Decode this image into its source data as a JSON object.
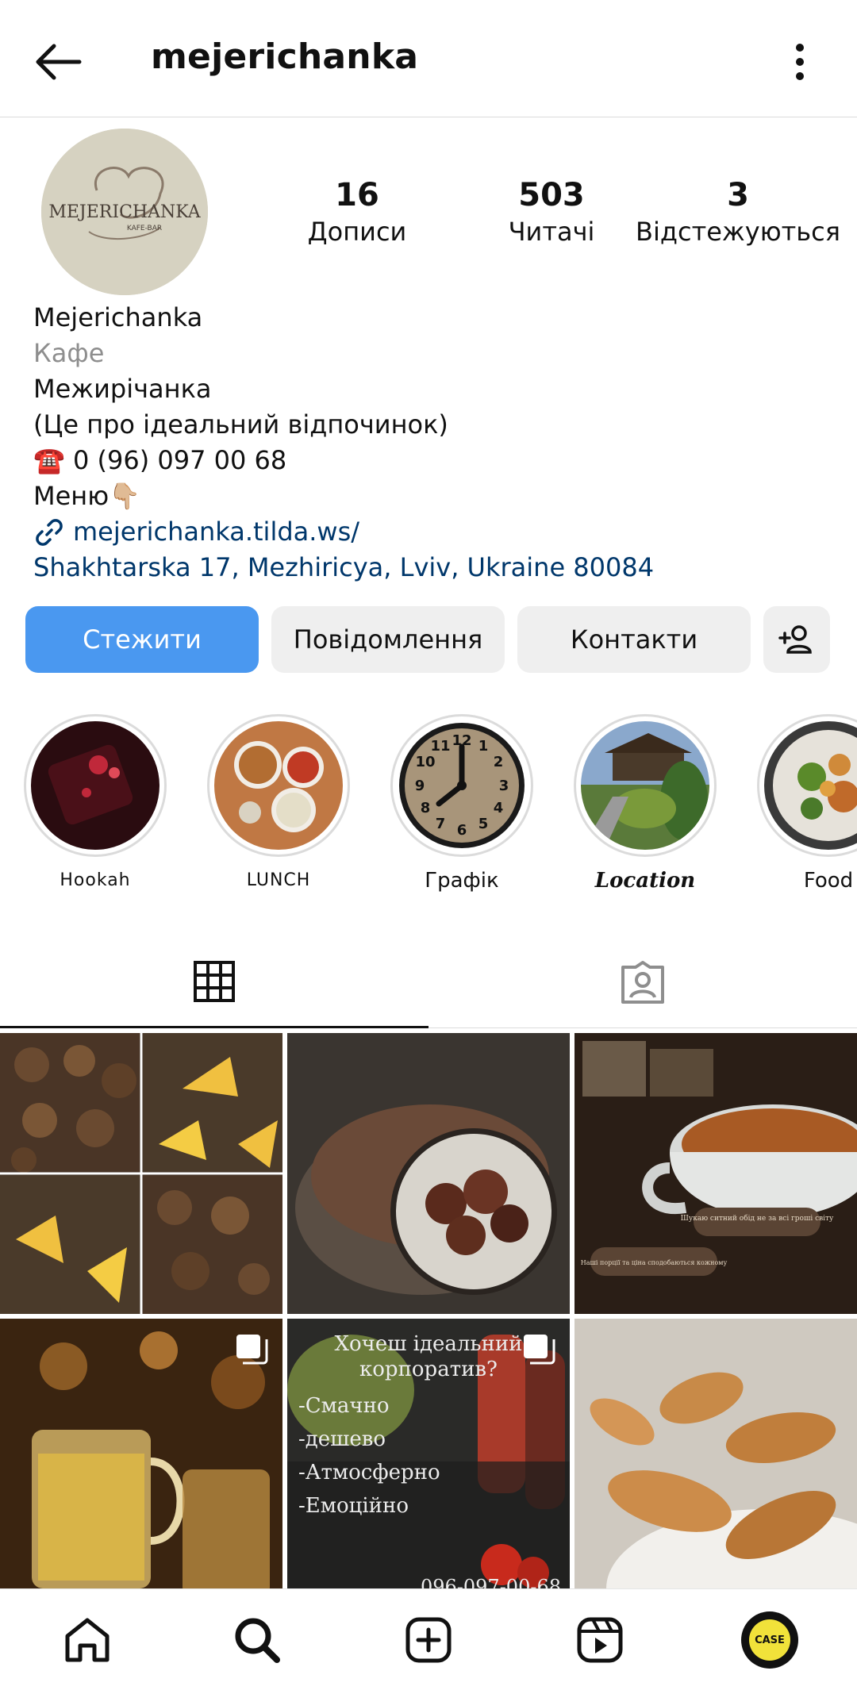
{
  "header": {
    "username": "mejerichanka"
  },
  "profile": {
    "avatar_text": "MEJERICHANKA",
    "avatar_subtext": "KAFE-BAR",
    "stats": [
      {
        "value": "16",
        "label": "Дописи"
      },
      {
        "value": "503",
        "label": "Читачі"
      },
      {
        "value": "3",
        "label": "Відстежуються"
      }
    ],
    "name": "Mejerichanka",
    "category": "Кафе",
    "bio_lines": [
      "Межирічанка",
      "(Це про ідеальний відпочинок)",
      "☎️ 0 (96) 097 00 68",
      "Меню👇🏼"
    ],
    "link": "mejerichanka.tilda.ws/",
    "address": "Shakhtarska 17, Mezhiricya, Lviv, Ukraine 80084"
  },
  "actions": {
    "follow": "Стежити",
    "message": "Повідомлення",
    "contacts": "Контакти"
  },
  "highlights": [
    {
      "label": "Hookah"
    },
    {
      "label": "LUNCH"
    },
    {
      "label": "Графік"
    },
    {
      "label": "Location"
    },
    {
      "label": "Food"
    }
  ],
  "posts": {
    "post5_text": [
      "Хочеш ідеальний",
      "корпоратив?",
      "-Смачно",
      "-дешево",
      "-Атмосферно",
      "-Емоційно"
    ],
    "post5_phone": "096-097-00-68",
    "post3_text_1": "Шукаю ситний обід не за всі гроші світу",
    "post3_text_2": "Наші порції та ціна сподобаються кожному"
  },
  "nav_avatar_text": "CASE",
  "colors": {
    "follow_button": "#4a98f0",
    "link": "#00376b",
    "secondary_button": "#efefef"
  },
  "icons": [
    "back-arrow-icon",
    "more-vertical-icon",
    "link-icon",
    "add-person-icon",
    "grid-icon",
    "tagged-icon",
    "home-icon",
    "search-icon",
    "create-icon",
    "reels-icon"
  ]
}
